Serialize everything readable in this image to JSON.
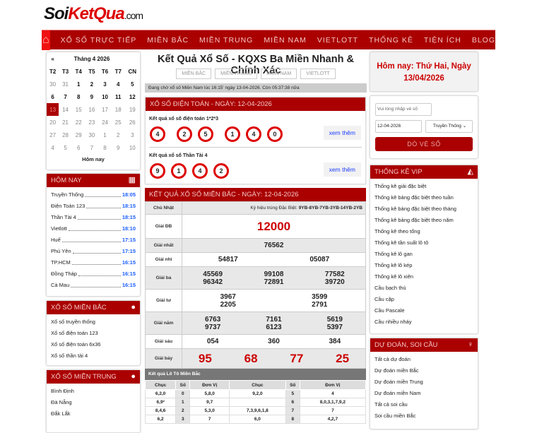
{
  "logo": {
    "a": "Soi",
    "b": "KetQua",
    "c": ".com"
  },
  "nav": [
    "XỔ SỐ TRỰC TIẾP",
    "MIỀN BẮC",
    "MIỀN TRUNG",
    "MIỀN NAM",
    "VIETLOTT",
    "THỐNG KÊ",
    "TIỆN ÍCH",
    "BLOG"
  ],
  "calendar": {
    "prev": "«",
    "month": "Tháng 4 2026",
    "days": [
      "T2",
      "T3",
      "T4",
      "T5",
      "T6",
      "T7",
      "CN"
    ],
    "weeks": [
      [
        "30",
        "31",
        "1",
        "2",
        "3",
        "4",
        "5"
      ],
      [
        "6",
        "7",
        "8",
        "9",
        "10",
        "11",
        "12"
      ],
      [
        "13",
        "14",
        "15",
        "16",
        "17",
        "18",
        "19"
      ],
      [
        "20",
        "21",
        "22",
        "23",
        "24",
        "25",
        "26"
      ],
      [
        "27",
        "28",
        "29",
        "30",
        "1",
        "2",
        "3"
      ],
      [
        "4",
        "5",
        "6",
        "7",
        "8",
        "9",
        "10"
      ]
    ],
    "today_btn": "Hôm nay"
  },
  "today": {
    "title": "HÔM NAY",
    "items": [
      [
        "Truyền Thống",
        "18:05"
      ],
      [
        "Điện Toán 123",
        "18:15"
      ],
      [
        "Thần Tài 4",
        "18:15"
      ],
      [
        "Vietlott",
        "18:10"
      ],
      [
        "Huế",
        "17:15"
      ],
      [
        "Phú Yên",
        "17:15"
      ],
      [
        "TP.HCM",
        "16:15"
      ],
      [
        "Đồng Tháp",
        "16:15"
      ],
      [
        "Cà Mau",
        "16:15"
      ]
    ]
  },
  "mienbac": {
    "title": "XỔ SỐ MIỀN BẮC",
    "items": [
      "Xổ số truyền thống",
      "Xổ số điện toán 123",
      "Xổ số điện toán 6x36",
      "Xổ số thần tài 4"
    ]
  },
  "mientrung": {
    "title": "XỔ SỐ MIỀN TRUNG",
    "items": [
      "Bình Định",
      "Đà Nẵng",
      "Đắk Lắk"
    ]
  },
  "main": {
    "title": "Kết Quả Xổ Số - KQXS Ba Miền Nhanh & Chính Xác",
    "tabs": [
      "MIỀN BẮC",
      "MIỀN TRUNG",
      "MIỀN NAM",
      "VIETLOTT"
    ],
    "status": "Đang chờ xổ số Miền Nam lúc 16:15' ngày 13-04-2026. Còn 05:37:38 nữa"
  },
  "dientoan": {
    "title": "XỔ SỐ ĐIỆN TOÁN - NGÀY: 12-04-2026",
    "more": "xem thêm",
    "g1": {
      "label": "Kết quả xổ số điện toán 1*2*3",
      "balls": [
        "4",
        "2",
        "5",
        "1",
        "4",
        "0"
      ]
    },
    "g2": {
      "label": "Kết quả xổ số Thần Tài 4",
      "balls": [
        "9",
        "1",
        "4",
        "2"
      ]
    }
  },
  "kqmb": {
    "title": "KẾT QUẢ XỔ SỐ MIỀN BẮC - NGÀY: 12-04-2026",
    "day": "Chủ Nhật",
    "kyhieu_label": "Ký hiệu trúng Đặc Biệt:",
    "kyhieu": "9YB-8YB-7YB-3YB-14YB-2YB",
    "rows": [
      {
        "name": "Giải ĐB",
        "nums": [
          [
            "12000"
          ]
        ],
        "big": true
      },
      {
        "name": "Giải nhất",
        "nums": [
          [
            "76562"
          ]
        ]
      },
      {
        "name": "Giải nhì",
        "nums": [
          [
            "54817",
            "05087"
          ]
        ]
      },
      {
        "name": "Giải ba",
        "nums": [
          [
            "45569",
            "99108",
            "77582"
          ],
          [
            "96342",
            "72891",
            "39720"
          ]
        ]
      },
      {
        "name": "Giải tư",
        "nums": [
          [
            "3967",
            "3599"
          ],
          [
            "2205",
            "2791"
          ]
        ]
      },
      {
        "name": "Giải năm",
        "nums": [
          [
            "6763",
            "7161",
            "5619"
          ],
          [
            "9737",
            "6123",
            "5397"
          ]
        ]
      },
      {
        "name": "Giải sáu",
        "nums": [
          [
            "054",
            "360",
            "384"
          ]
        ]
      },
      {
        "name": "Giải bảy",
        "nums": [
          [
            "95",
            "68",
            "77",
            "25"
          ]
        ],
        "red": true
      }
    ]
  },
  "loto": {
    "title": "Kết quả Lô Tô Miền Bắc",
    "headers": [
      "Chục",
      "Số",
      "Đơn Vị",
      "Chục",
      "Số",
      "Đơn Vị"
    ],
    "rows": [
      [
        "6,2,0",
        "0",
        "5,8,0",
        "9,2,0",
        "5",
        "4"
      ],
      [
        "6,9²",
        "1",
        "9,7",
        "",
        "6",
        "8,0,3,1,7,9,2"
      ],
      [
        "8,4,6",
        "2",
        "5,3,0",
        "7,3,9,6,1,8",
        "7",
        "7"
      ],
      [
        "6,2",
        "3",
        "7",
        "6,0",
        "8",
        "4,2,7"
      ]
    ]
  },
  "right": {
    "today": "Hôm nay: Thứ Hai, Ngày 13/04/2026",
    "ticket_placeholder": "Vui lòng nhập vé số",
    "date": "12-04-2026",
    "type": "Truyền Thống",
    "check_btn": "DÒ VÉ SỐ"
  },
  "vip": {
    "title": "THỐNG KÊ VIP",
    "items": [
      "Thống kê giải đặc biệt",
      "Thống kê bảng đặc biệt theo tuần",
      "Thống kê bảng đặc biệt theo tháng",
      "Thống kê bảng đặc biệt theo năm",
      "Thống kê theo tổng",
      "Thống kê tần suất lô tô",
      "Thống kê lô gan",
      "Thống kê lô kép",
      "Thống kê lô xiên",
      "Cầu bạch thủ",
      "Cầu cặp",
      "Cầu Pascale",
      "Cầu nhiều nháy"
    ]
  },
  "dudoan": {
    "title": "DỰ ĐOÁN, SOI CẦU",
    "items": [
      "Tất cả dự đoán",
      "Dự đoán miền Bắc",
      "Dự đoán miền Trung",
      "Dự đoán miền Nam",
      "Tất cả soi cầu",
      "Soi cầu miền Bắc"
    ]
  }
}
